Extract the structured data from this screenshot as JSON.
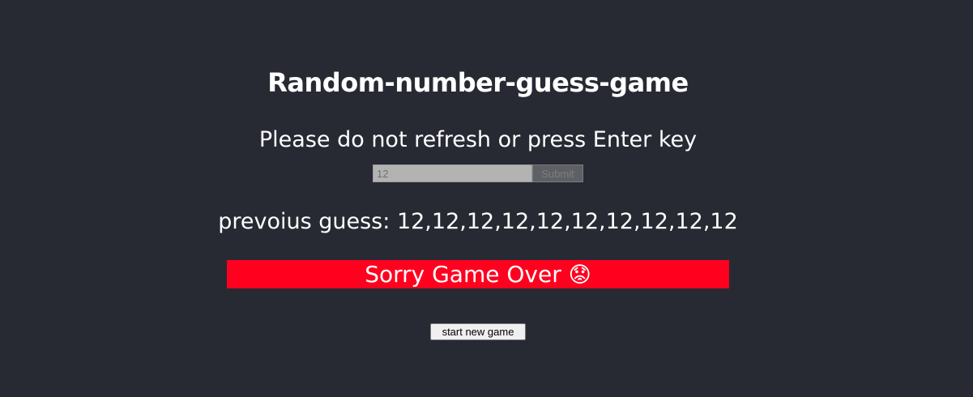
{
  "game": {
    "title": "Random-number-guess-game",
    "instruction": "Please do not refresh or press Enter key",
    "guess_input": {
      "value": "12",
      "placeholder": ""
    },
    "submit_label": "Submit",
    "previous_guess_label": "prevoius guess:",
    "previous_guesses": "12,12,12,12,12,12,12,12,12,12",
    "status_text": "Sorry Game Over",
    "status_emoji": "😟",
    "new_game_label": "start new game"
  },
  "colors": {
    "background": "#272a33",
    "status_banner": "#ff001f",
    "text": "#ffffff"
  }
}
